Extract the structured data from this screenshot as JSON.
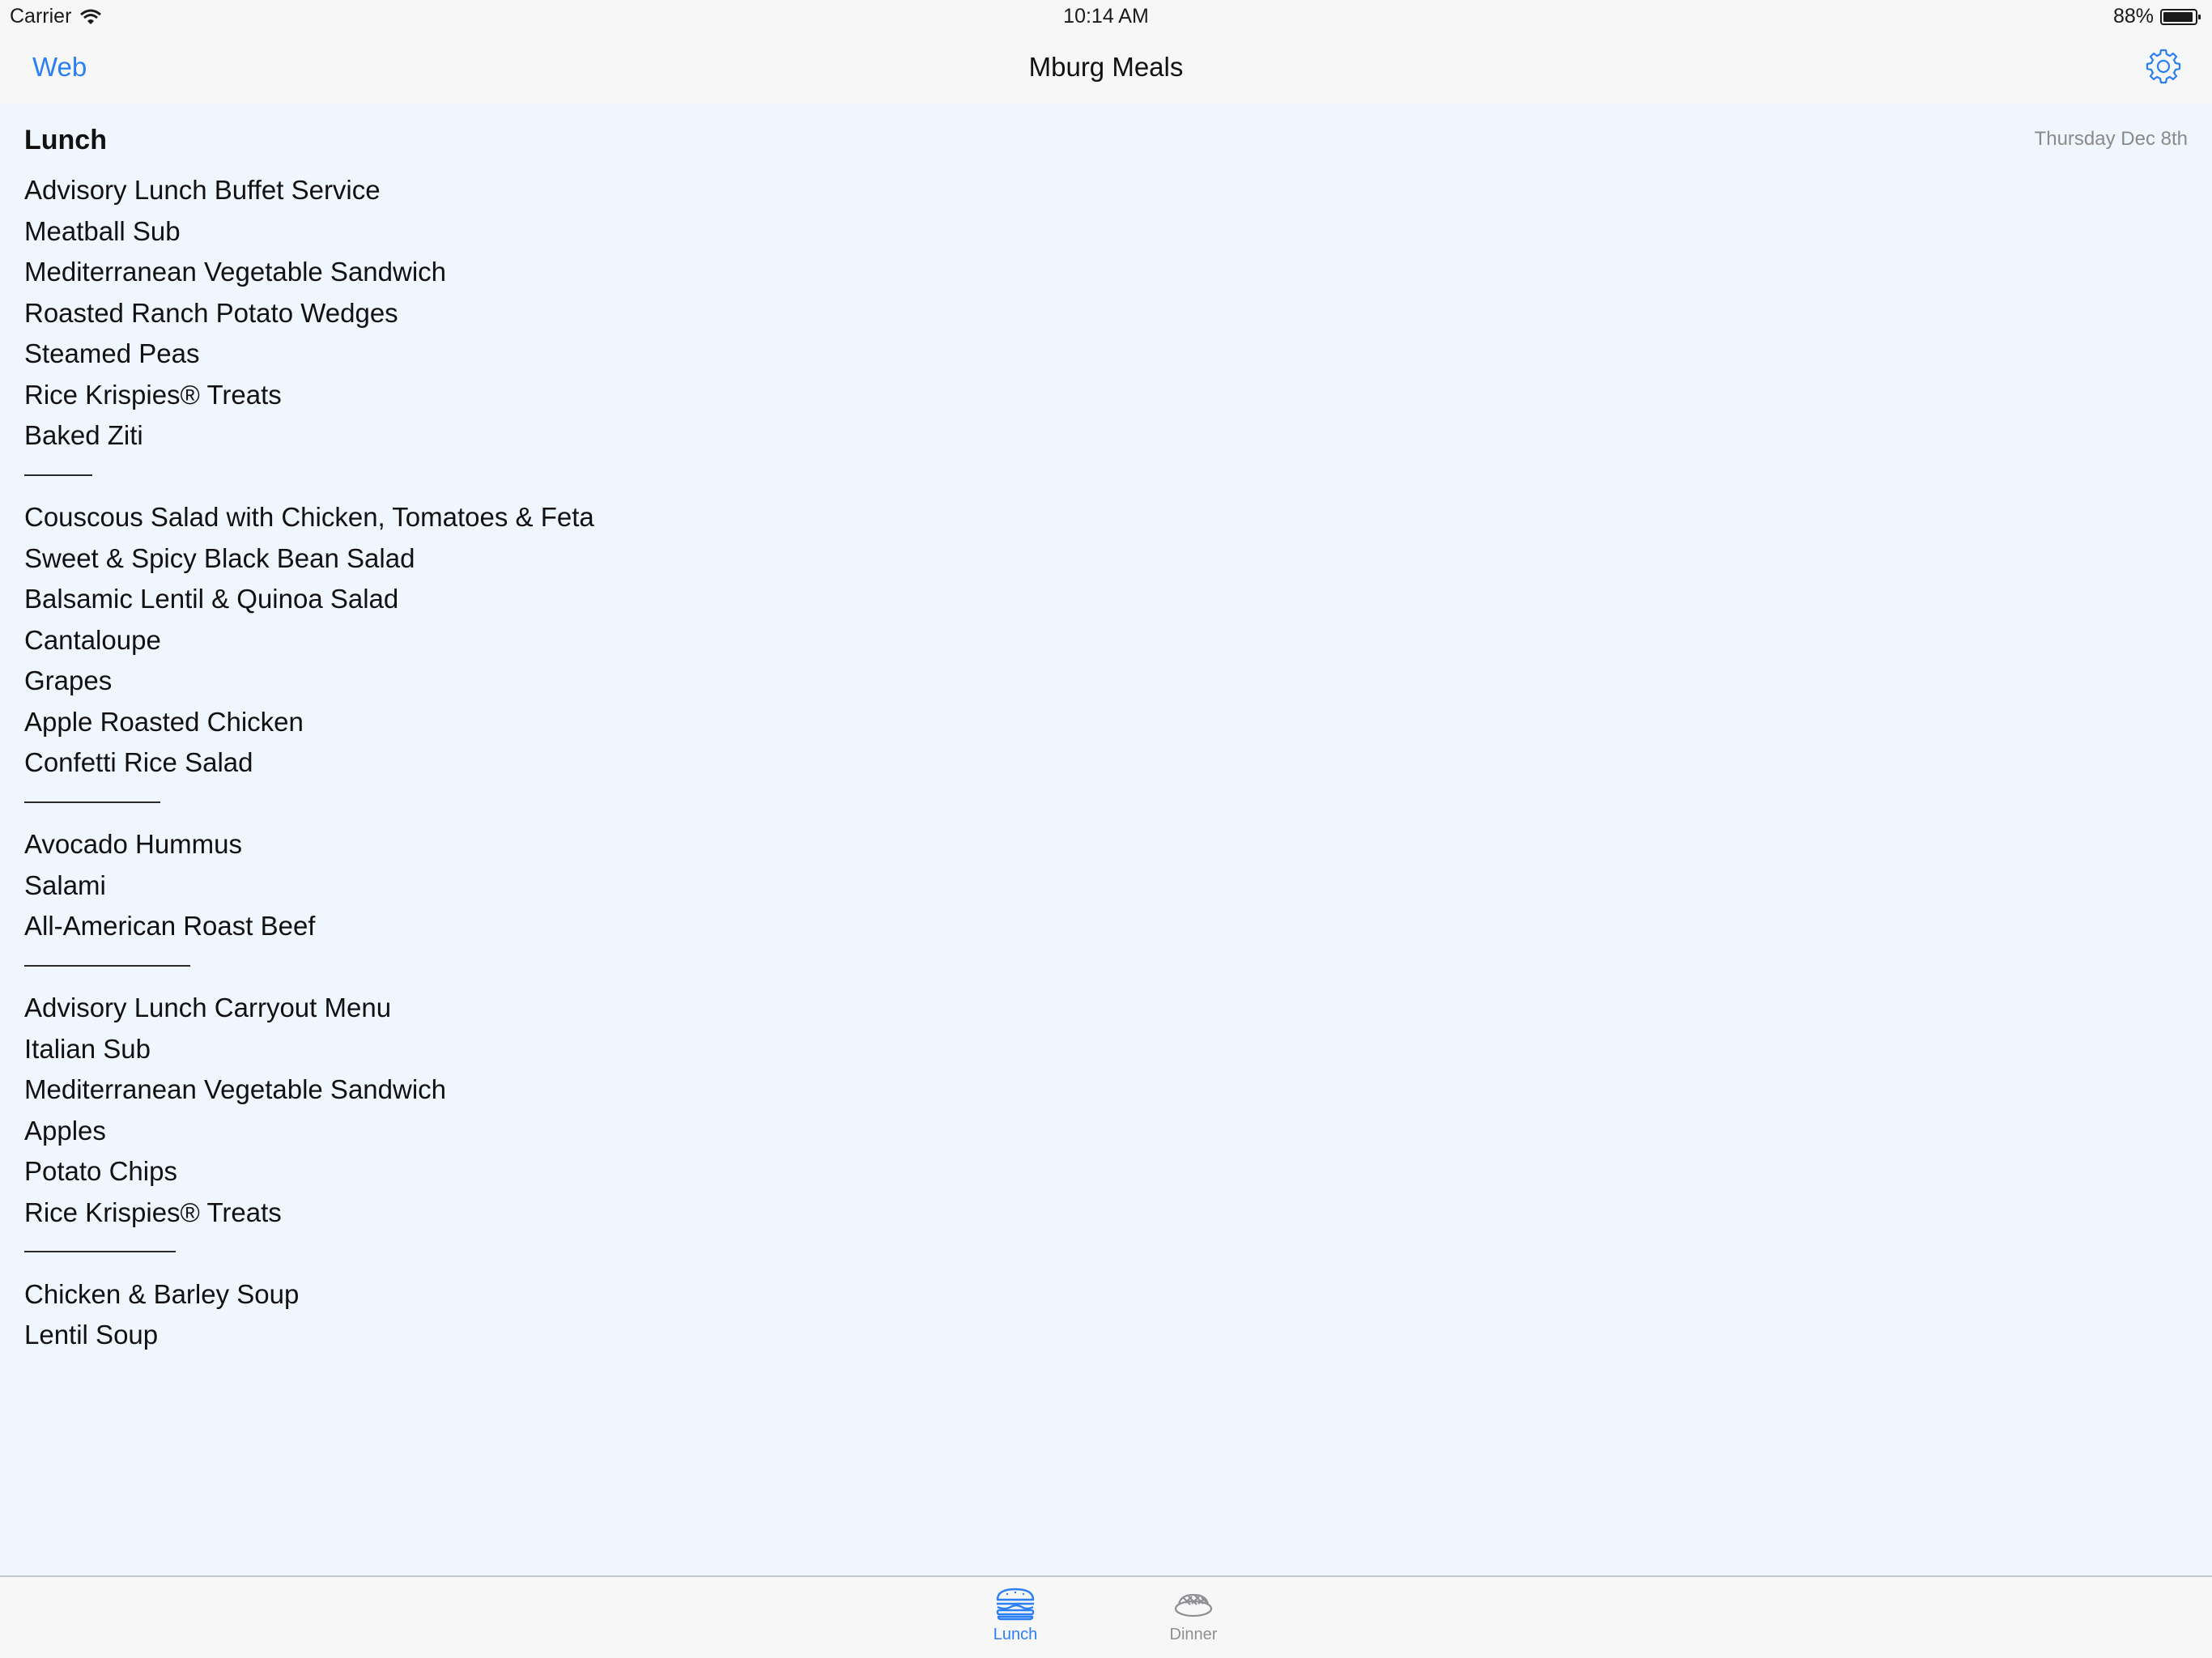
{
  "status_bar": {
    "carrier": "Carrier",
    "time": "10:14 AM",
    "battery": "88%"
  },
  "nav_bar": {
    "back_label": "Web",
    "title": "Mburg Meals",
    "settings_icon": "gear-icon"
  },
  "content": {
    "section_title": "Lunch",
    "date": "Thursday Dec 8th",
    "groups": [
      [
        "Advisory Lunch Buffet Service",
        "Meatball Sub",
        "Mediterranean Vegetable Sandwich",
        "Roasted Ranch Potato Wedges",
        "Steamed Peas",
        "Rice Krispies® Treats",
        "Baked Ziti"
      ],
      [
        "Couscous Salad with Chicken, Tomatoes & Feta",
        "Sweet & Spicy Black Bean Salad",
        "Balsamic Lentil & Quinoa Salad",
        "Cantaloupe",
        "Grapes",
        "Apple Roasted Chicken",
        "Confetti Rice Salad"
      ],
      [
        "Avocado Hummus",
        "Salami",
        "All-American Roast Beef"
      ],
      [
        "Advisory Lunch Carryout Menu",
        "Italian Sub",
        "Mediterranean Vegetable Sandwich",
        "Apples",
        "Potato Chips",
        "Rice Krispies® Treats"
      ],
      [
        "Chicken & Barley Soup",
        "Lentil Soup"
      ]
    ]
  },
  "tab_bar": {
    "tabs": [
      {
        "label": "Lunch",
        "icon": "burger-icon",
        "selected": true
      },
      {
        "label": "Dinner",
        "icon": "dinner-plate-icon",
        "selected": false
      }
    ]
  },
  "colors": {
    "accent": "#2a7ef6",
    "background": "#f0f6fe",
    "bar_background": "#f7f7f7"
  }
}
